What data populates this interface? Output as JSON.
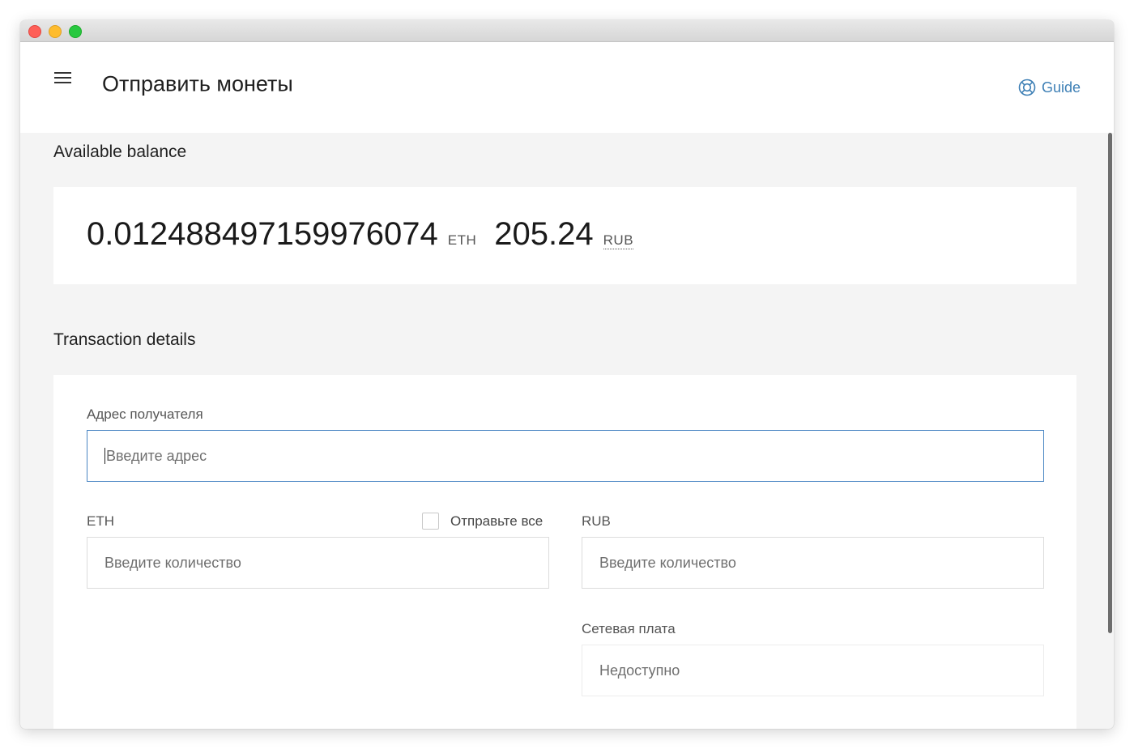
{
  "header": {
    "title": "Отправить монеты",
    "guide_label": "Guide",
    "accent_color": "#3d7fb5"
  },
  "balance": {
    "section_title": "Available balance",
    "eth_amount": "0.012488497159976074",
    "eth_unit": "ETH",
    "fiat_amount": "205.24",
    "fiat_unit": "RUB"
  },
  "transaction": {
    "section_title": "Transaction details",
    "recipient": {
      "label": "Адрес получателя",
      "placeholder": "Введите адрес"
    },
    "eth": {
      "label": "ETH",
      "placeholder": "Введите количество"
    },
    "send_all": {
      "label": "Отправьте все",
      "checked": false
    },
    "rub": {
      "label": "RUB",
      "placeholder": "Введите количество"
    },
    "fee": {
      "label": "Сетевая плата",
      "value": "Недоступно"
    }
  },
  "icons": {
    "menu": "hamburger-menu-icon",
    "guide": "lifebuoy-icon"
  }
}
